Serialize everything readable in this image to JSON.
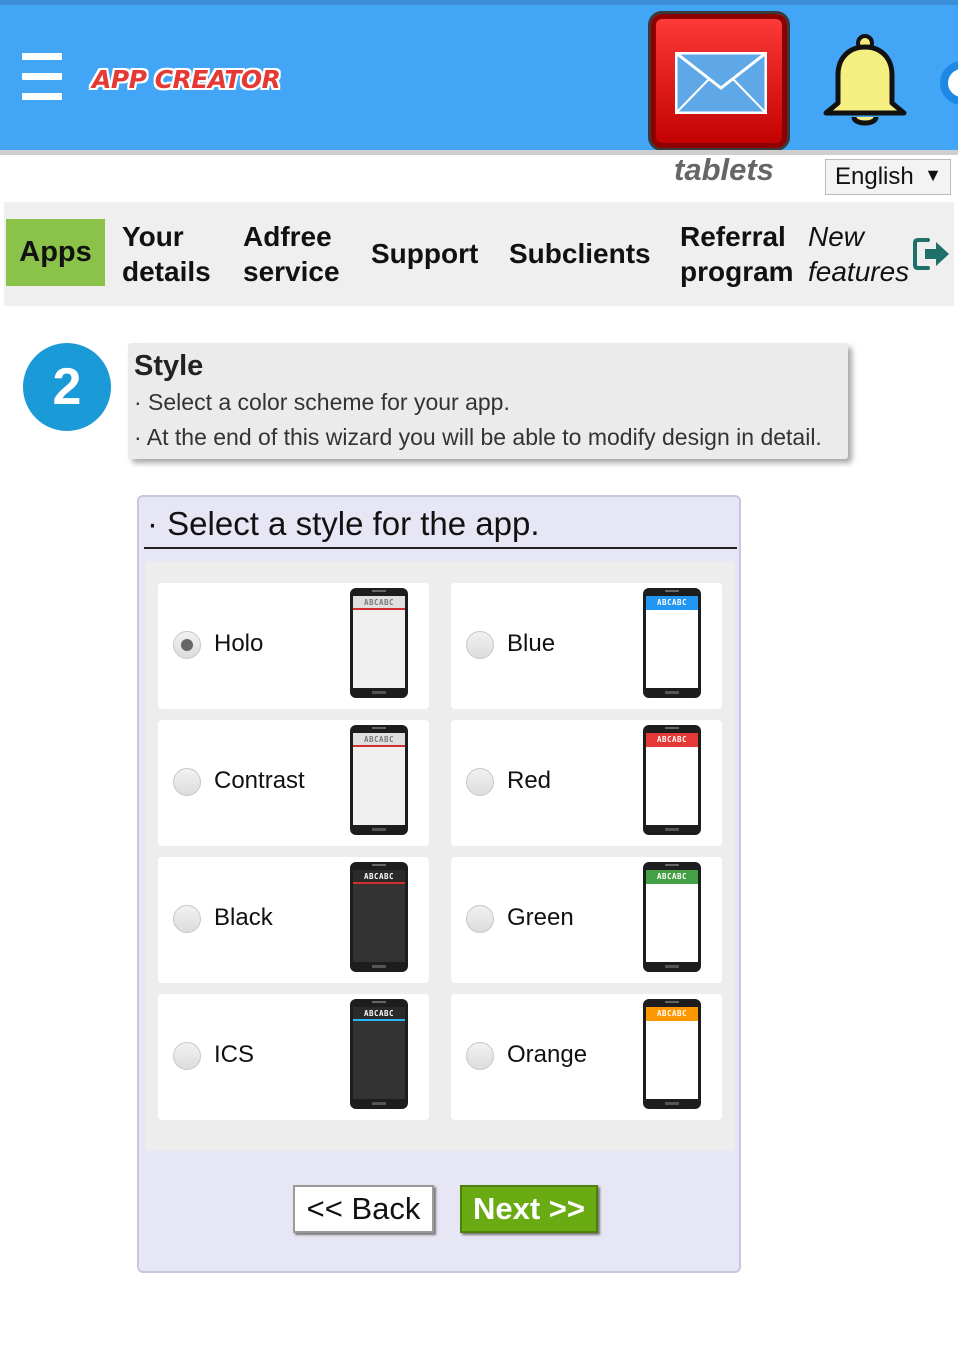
{
  "header": {
    "logo_text": "APP CREATOR",
    "menu_icon": "hamburger-menu-icon",
    "mail_icon": "envelope-icon",
    "bell_icon": "bell-icon",
    "platform_label": "tablets",
    "language": "English"
  },
  "nav": {
    "apps": "Apps",
    "your_details": [
      "Your",
      "details"
    ],
    "adfree": [
      "Adfree",
      "service"
    ],
    "support": "Support",
    "subclients": "Subclients",
    "referral": [
      "Referral",
      "program"
    ],
    "new_features": [
      "New",
      "features"
    ],
    "exit_icon": "exit-icon"
  },
  "step": {
    "number": "2",
    "title": "Style",
    "line1": "· Select a color scheme for your app.",
    "line2": "· At the end of this wizard you will be able to modify design in detail."
  },
  "style_panel": {
    "title": "· Select a style for the app.",
    "preview_bar_text": "ABCABC",
    "options": [
      {
        "label": "Holo",
        "checked": true,
        "bar_color": "#e0e0e0",
        "accent": "#d32f2f",
        "screen": "#f0f0f0"
      },
      {
        "label": "Blue",
        "checked": false,
        "bar_color": "#2196f3",
        "accent": "#2196f3",
        "screen": "#ffffff"
      },
      {
        "label": "Contrast",
        "checked": false,
        "bar_color": "#e0e0e0",
        "accent": "#d32f2f",
        "screen": "#f0f0f0"
      },
      {
        "label": "Red",
        "checked": false,
        "bar_color": "#e53935",
        "accent": "#e53935",
        "screen": "#ffffff"
      },
      {
        "label": "Black",
        "checked": false,
        "bar_color": "#2a2a2a",
        "accent": "#d32f2f",
        "screen": "#333333"
      },
      {
        "label": "Green",
        "checked": false,
        "bar_color": "#43a047",
        "accent": "#43a047",
        "screen": "#ffffff"
      },
      {
        "label": "ICS",
        "checked": false,
        "bar_color": "#2a2a2a",
        "accent": "#29b6f6",
        "screen": "#333333"
      },
      {
        "label": "Orange",
        "checked": false,
        "bar_color": "#ff9800",
        "accent": "#ff9800",
        "screen": "#ffffff"
      }
    ],
    "back_label": "<< Back",
    "next_label": "Next >>"
  },
  "colors": {
    "header_blue": "#42a5f5",
    "apps_green": "#8bc34a",
    "next_green": "#6aaa12",
    "step_blue": "#1a9ad6"
  }
}
